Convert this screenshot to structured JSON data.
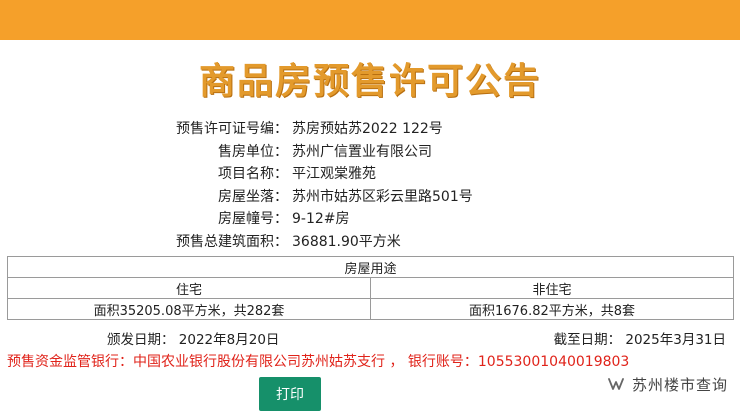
{
  "header": {
    "title": "商品房预售许可公告"
  },
  "info": [
    {
      "label": "预售许可证号编：",
      "value": "苏房预姑苏2022 122号"
    },
    {
      "label": "售房单位：",
      "value": "苏州广信置业有限公司"
    },
    {
      "label": "项目名称：",
      "value": "平江观棠雅苑"
    },
    {
      "label": "房屋坐落：",
      "value": "苏州市姑苏区彩云里路501号"
    },
    {
      "label": "房屋幢号：",
      "value": "9-12#房"
    },
    {
      "label": "预售总建筑面积：",
      "value": "36881.90平方米"
    }
  ],
  "usage": {
    "header": "房屋用途",
    "columns": [
      "住宅",
      "非住宅"
    ],
    "values": [
      "面积35205.08平方米，共282套",
      "面积1676.82平方米，共8套"
    ]
  },
  "dates": {
    "issue": "颁发日期：  2022年8月20日",
    "expire": "截至日期：  2025年3月31日"
  },
  "bank": "预售资金监管银行：中国农业银行股份有限公司苏州姑苏支行  ，  银行账号：10553001040019803",
  "actions": {
    "print_label": "打印"
  },
  "watermark": {
    "text": "苏州楼市查询",
    "icon": "wechat-channel-icon"
  },
  "colors": {
    "topbar": "#f5a02a",
    "title": "#e39a2c",
    "bank": "#e0231a",
    "button": "#16906a"
  }
}
